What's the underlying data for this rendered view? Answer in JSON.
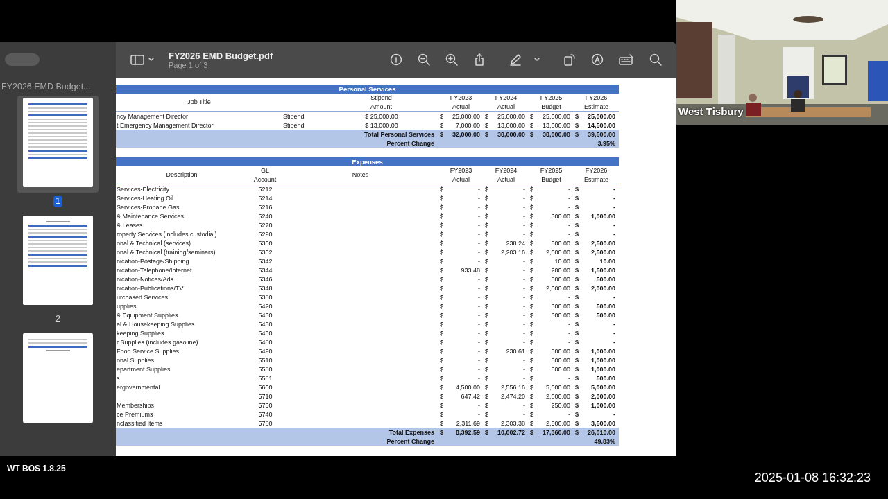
{
  "viewer": {
    "title": "FY2026 EMD Budget.pdf",
    "page_info": "Page 1 of 3",
    "sidebar": {
      "title": "FY2026 EMD Budget...",
      "thumbnails": [
        {
          "label": "1",
          "selected": true
        },
        {
          "label": "2",
          "selected": false
        },
        {
          "selected": false
        }
      ]
    }
  },
  "document": {
    "personal_services": {
      "title": "Personal Services",
      "headers": [
        {
          "text": "Job Title"
        },
        {
          "text": "Stipend",
          "subtext": "Amount"
        },
        {
          "text": "FY2023",
          "subtext": "Actual"
        },
        {
          "text": "FY2024",
          "subtext": "Actual"
        },
        {
          "text": "FY2025",
          "subtext": "Budget"
        },
        {
          "text": "FY2026",
          "subtext": "Estimate"
        }
      ],
      "rows": [
        {
          "job_title": "ncy Management Director",
          "pay_type": "Stipend",
          "stipend_amount": "$ 25,000.00",
          "amounts": [
            [
              "$",
              "25,000.00"
            ],
            [
              "$",
              "25,000.00"
            ],
            [
              "$",
              "25,000.00"
            ],
            [
              "$",
              "25,000.00"
            ]
          ]
        },
        {
          "job_title": "t Emergency Management Director",
          "pay_type": "Stipend",
          "stipend_amount": "$ 13,000.00",
          "amounts": [
            [
              "$",
              "7,000.00"
            ],
            [
              "$",
              "13,000.00"
            ],
            [
              "$",
              "13,000.00"
            ],
            [
              "$",
              "14,500.00"
            ]
          ]
        }
      ],
      "total": {
        "label": "Total Personal Services",
        "amounts": [
          [
            "$",
            "32,000.00"
          ],
          [
            "$",
            "38,000.00"
          ],
          [
            "$",
            "38,000.00"
          ],
          [
            "$",
            "39,500.00"
          ]
        ]
      },
      "percent_change": {
        "label": "Percent Change",
        "value": "3.95%"
      }
    },
    "expenses": {
      "title": "Expenses",
      "headers": [
        {
          "text": "Description"
        },
        {
          "text": "GL",
          "subtext": "Account"
        },
        {
          "text": "Notes"
        },
        {
          "text": "FY2023",
          "subtext": "Actual"
        },
        {
          "text": "FY2024",
          "subtext": "Actual"
        },
        {
          "text": "FY2025",
          "subtext": "Budget"
        },
        {
          "text": "FY2026",
          "subtext": "Estimate"
        }
      ],
      "rows": [
        {
          "description": "Services-Electricity",
          "account": "5212",
          "amounts": [
            [
              "$",
              "-"
            ],
            [
              "$",
              "-"
            ],
            [
              "$",
              "-"
            ],
            [
              "$",
              "-"
            ]
          ]
        },
        {
          "description": "Services-Heating Oil",
          "account": "5214",
          "amounts": [
            [
              "$",
              "-"
            ],
            [
              "$",
              "-"
            ],
            [
              "$",
              "-"
            ],
            [
              "$",
              "-"
            ]
          ]
        },
        {
          "description": "Services-Propane Gas",
          "account": "5216",
          "amounts": [
            [
              "$",
              "-"
            ],
            [
              "$",
              "-"
            ],
            [
              "$",
              "-"
            ],
            [
              "$",
              "-"
            ]
          ]
        },
        {
          "description": "& Maintenance Services",
          "account": "5240",
          "amounts": [
            [
              "$",
              "-"
            ],
            [
              "$",
              "-"
            ],
            [
              "$",
              "300.00"
            ],
            [
              "$",
              "1,000.00"
            ]
          ]
        },
        {
          "description": "& Leases",
          "account": "5270",
          "amounts": [
            [
              "$",
              "-"
            ],
            [
              "$",
              "-"
            ],
            [
              "$",
              "-"
            ],
            [
              "$",
              "-"
            ]
          ]
        },
        {
          "description": "roperty Services (includes custodial)",
          "account": "5290",
          "amounts": [
            [
              "$",
              "-"
            ],
            [
              "$",
              "-"
            ],
            [
              "$",
              "-"
            ],
            [
              "$",
              "-"
            ]
          ]
        },
        {
          "description": "onal & Technical (services)",
          "account": "5300",
          "amounts": [
            [
              "$",
              "-"
            ],
            [
              "$",
              "238.24"
            ],
            [
              "$",
              "500.00"
            ],
            [
              "$",
              "2,500.00"
            ]
          ]
        },
        {
          "description": "onal & Technical (training/seminars)",
          "account": "5302",
          "amounts": [
            [
              "$",
              "-"
            ],
            [
              "$",
              "2,203.16"
            ],
            [
              "$",
              "2,000.00"
            ],
            [
              "$",
              "2,500.00"
            ]
          ]
        },
        {
          "description": "nication-Postage/Shipping",
          "account": "5342",
          "amounts": [
            [
              "$",
              "-"
            ],
            [
              "$",
              "-"
            ],
            [
              "$",
              "10.00"
            ],
            [
              "$",
              "10.00"
            ]
          ]
        },
        {
          "description": "nication-Telephone/Internet",
          "account": "5344",
          "amounts": [
            [
              "$",
              "933.48"
            ],
            [
              "$",
              "-"
            ],
            [
              "$",
              "200.00"
            ],
            [
              "$",
              "1,500.00"
            ]
          ]
        },
        {
          "description": "nication-Notices/Ads",
          "account": "5346",
          "amounts": [
            [
              "$",
              "-"
            ],
            [
              "$",
              "-"
            ],
            [
              "$",
              "500.00"
            ],
            [
              "$",
              "500.00"
            ]
          ]
        },
        {
          "description": "nication-Publications/TV",
          "account": "5348",
          "amounts": [
            [
              "$",
              "-"
            ],
            [
              "$",
              "-"
            ],
            [
              "$",
              "2,000.00"
            ],
            [
              "$",
              "2,000.00"
            ]
          ]
        },
        {
          "description": "urchased Services",
          "account": "5380",
          "amounts": [
            [
              "$",
              "-"
            ],
            [
              "$",
              "-"
            ],
            [
              "$",
              "-"
            ],
            [
              "$",
              "-"
            ]
          ]
        },
        {
          "description": "upplies",
          "account": "5420",
          "amounts": [
            [
              "$",
              "-"
            ],
            [
              "$",
              "-"
            ],
            [
              "$",
              "300.00"
            ],
            [
              "$",
              "500.00"
            ]
          ]
        },
        {
          "description": "& Equipment Supplies",
          "account": "5430",
          "amounts": [
            [
              "$",
              "-"
            ],
            [
              "$",
              "-"
            ],
            [
              "$",
              "300.00"
            ],
            [
              "$",
              "500.00"
            ]
          ]
        },
        {
          "description": "al & Housekeeping Supplies",
          "account": "5450",
          "amounts": [
            [
              "$",
              "-"
            ],
            [
              "$",
              "-"
            ],
            [
              "$",
              "-"
            ],
            [
              "$",
              "-"
            ]
          ]
        },
        {
          "description": "keeping Supplies",
          "account": "5460",
          "amounts": [
            [
              "$",
              "-"
            ],
            [
              "$",
              "-"
            ],
            [
              "$",
              "-"
            ],
            [
              "$",
              "-"
            ]
          ]
        },
        {
          "description": "r Supplies (includes gasoline)",
          "account": "5480",
          "amounts": [
            [
              "$",
              "-"
            ],
            [
              "$",
              "-"
            ],
            [
              "$",
              "-"
            ],
            [
              "$",
              "-"
            ]
          ]
        },
        {
          "description": "Food Service Supplies",
          "account": "5490",
          "amounts": [
            [
              "$",
              "-"
            ],
            [
              "$",
              "230.61"
            ],
            [
              "$",
              "500.00"
            ],
            [
              "$",
              "1,000.00"
            ]
          ]
        },
        {
          "description": "onal Supplies",
          "account": "5510",
          "amounts": [
            [
              "$",
              "-"
            ],
            [
              "$",
              "-"
            ],
            [
              "$",
              "500.00"
            ],
            [
              "$",
              "1,000.00"
            ]
          ]
        },
        {
          "description": "epartment Supplies",
          "account": "5580",
          "amounts": [
            [
              "$",
              "-"
            ],
            [
              "$",
              "-"
            ],
            [
              "$",
              "500.00"
            ],
            [
              "$",
              "1,000.00"
            ]
          ]
        },
        {
          "description": "s",
          "account": "5581",
          "amounts": [
            [
              "$",
              "-"
            ],
            [
              "$",
              "-"
            ],
            [
              "$",
              "-"
            ],
            [
              "$",
              "500.00"
            ]
          ]
        },
        {
          "description": "ergovernmental",
          "account": "5600",
          "amounts": [
            [
              "$",
              "4,500.00"
            ],
            [
              "$",
              "2,556.16"
            ],
            [
              "$",
              "5,000.00"
            ],
            [
              "$",
              "5,000.00"
            ]
          ]
        },
        {
          "account": "5710",
          "amounts": [
            [
              "$",
              "647.42"
            ],
            [
              "$",
              "2,474.20"
            ],
            [
              "$",
              "2,000.00"
            ],
            [
              "$",
              "2,000.00"
            ]
          ]
        },
        {
          "description": "Memberships",
          "account": "5730",
          "amounts": [
            [
              "$",
              "-"
            ],
            [
              "$",
              "-"
            ],
            [
              "$",
              "250.00"
            ],
            [
              "$",
              "1,000.00"
            ]
          ]
        },
        {
          "description": "ce Premiums",
          "account": "5740",
          "amounts": [
            [
              "$",
              "-"
            ],
            [
              "$",
              "-"
            ],
            [
              "$",
              "-"
            ],
            [
              "$",
              "-"
            ]
          ]
        },
        {
          "description": "nclassified Items",
          "account": "5780",
          "amounts": [
            [
              "$",
              "2,311.69"
            ],
            [
              "$",
              "2,303.38"
            ],
            [
              "$",
              "2,500.00"
            ],
            [
              "$",
              "3,500.00"
            ]
          ]
        }
      ],
      "total": {
        "label": "Total Expenses",
        "amounts": [
          [
            "$",
            "8,392.59"
          ],
          [
            "$",
            "10,002.72"
          ],
          [
            "$",
            "17,360.00"
          ],
          [
            "$",
            "26,010.00"
          ]
        ]
      },
      "percent_change": {
        "label": "Percent Change",
        "value": "49.83%"
      }
    }
  },
  "camera": {
    "kind": "picture",
    "caption": "West Tisbury"
  },
  "overlay": {
    "program_label": "WT BOS 1.8.25",
    "timestamp": "2025-01-08 16:32:23"
  }
}
